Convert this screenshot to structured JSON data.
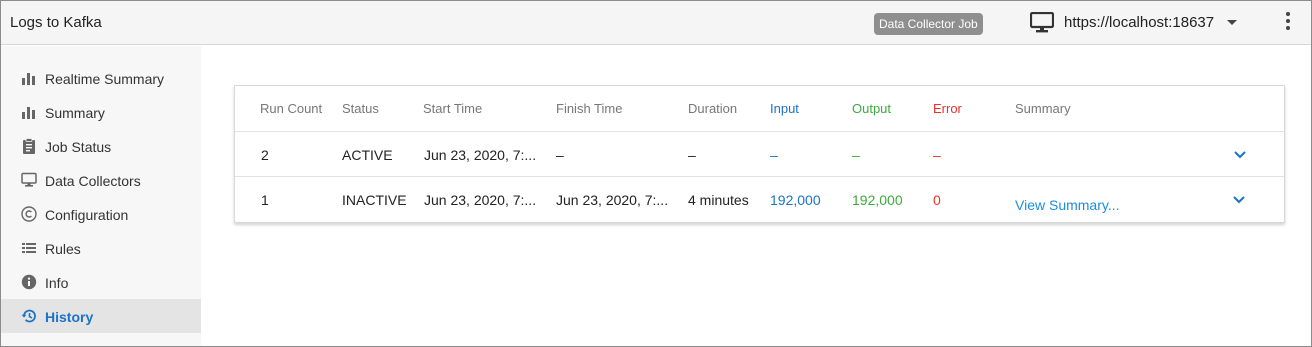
{
  "header": {
    "title": "Logs to Kafka",
    "badge": "Data Collector Job",
    "server_url": "https://localhost:18637",
    "icons": {
      "server": "monitor-icon",
      "dropdown": "caret-down-icon",
      "menu": "kebab-menu-icon"
    }
  },
  "sidebar": {
    "items": [
      {
        "label": "Realtime Summary",
        "icon": "bar-chart-icon",
        "active": false
      },
      {
        "label": "Summary",
        "icon": "bar-chart-icon",
        "active": false
      },
      {
        "label": "Job Status",
        "icon": "clipboard-icon",
        "active": false
      },
      {
        "label": "Data Collectors",
        "icon": "monitor-icon",
        "active": false
      },
      {
        "label": "Configuration",
        "icon": "copyright-circle-icon",
        "active": false
      },
      {
        "label": "Rules",
        "icon": "list-icon",
        "active": false
      },
      {
        "label": "Info",
        "icon": "info-icon",
        "active": false
      },
      {
        "label": "History",
        "icon": "history-icon",
        "active": true
      }
    ]
  },
  "table": {
    "columns": [
      "Run Count",
      "Status",
      "Start Time",
      "Finish Time",
      "Duration",
      "Input",
      "Output",
      "Error",
      "Summary"
    ],
    "rows": [
      {
        "run_count": "2",
        "status": "ACTIVE",
        "start_time": "Jun 23, 2020, 7:...",
        "finish_time": "–",
        "duration": "–",
        "input": "–",
        "output": "–",
        "error": "–",
        "summary": ""
      },
      {
        "run_count": "1",
        "status": "INACTIVE",
        "start_time": "Jun 23, 2020, 7:...",
        "finish_time": "Jun 23, 2020, 7:...",
        "duration": "4 minutes",
        "input": "192,000",
        "output": "192,000",
        "error": "0",
        "summary": "View Summary..."
      }
    ]
  },
  "colors": {
    "accent": "#1a73c7",
    "output_green": "#3cab3c",
    "error_red": "#e8322c",
    "link_blue": "#1a8fdc",
    "badge_gray": "#8f8f8f"
  }
}
